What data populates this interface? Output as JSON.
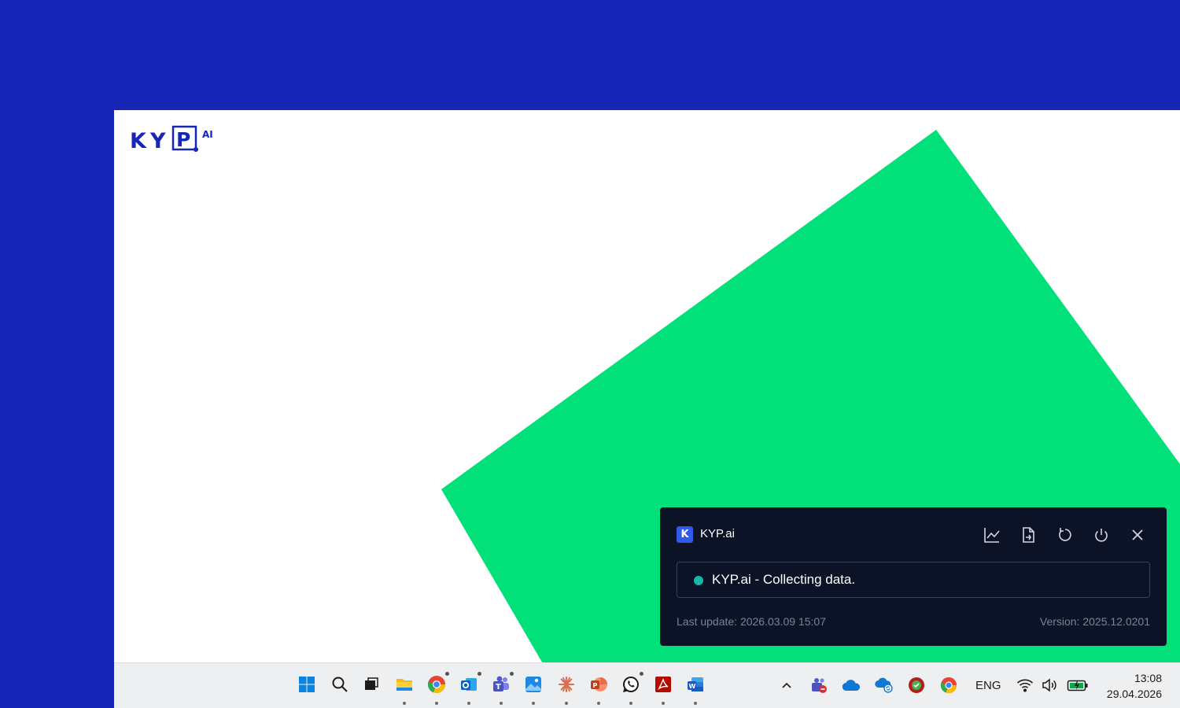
{
  "logo": {
    "text": "KYP",
    "superscript": "AI",
    "color": "#1826b8"
  },
  "colors": {
    "desktop_background": "#1826b8",
    "accent_green": "#02e07a",
    "popup_background": "#0d1326",
    "status_dot": "#14b8a6"
  },
  "popup": {
    "app_badge": "K",
    "app_title": "KYP.ai",
    "toolbar": [
      "chart-icon",
      "document-icon",
      "refresh-icon",
      "power-icon",
      "close-icon"
    ],
    "status_text": "KYP.ai - Collecting data.",
    "last_update": "Last update: 2026.03.09 15:07",
    "version": "Version: 2025.12.0201"
  },
  "taskbar": {
    "apps": [
      {
        "name": "start-icon",
        "running": false
      },
      {
        "name": "search-icon",
        "running": false
      },
      {
        "name": "task-view-icon",
        "running": false
      },
      {
        "name": "file-explorer-icon",
        "running": true
      },
      {
        "name": "chrome-icon",
        "running": true,
        "badge": true
      },
      {
        "name": "outlook-icon",
        "running": true,
        "badge": true
      },
      {
        "name": "teams-icon",
        "running": true,
        "badge": true
      },
      {
        "name": "photos-icon",
        "running": true
      },
      {
        "name": "claude-icon",
        "running": true
      },
      {
        "name": "powerpoint-icon",
        "running": true
      },
      {
        "name": "whatsapp-icon",
        "running": true,
        "badge": true
      },
      {
        "name": "acrobat-icon",
        "running": true
      },
      {
        "name": "word-icon",
        "running": true
      }
    ],
    "tray": {
      "icons": [
        "chevron-up-icon",
        "teams-tray-icon",
        "onedrive-icon",
        "onedrive-sync-icon",
        "antivirus-icon",
        "chrome-tray-icon"
      ],
      "language": "ENG",
      "status_icons": [
        "wifi-icon",
        "volume-icon",
        "battery-icon"
      ],
      "time": "13:08",
      "date": "29.04.2026"
    }
  }
}
